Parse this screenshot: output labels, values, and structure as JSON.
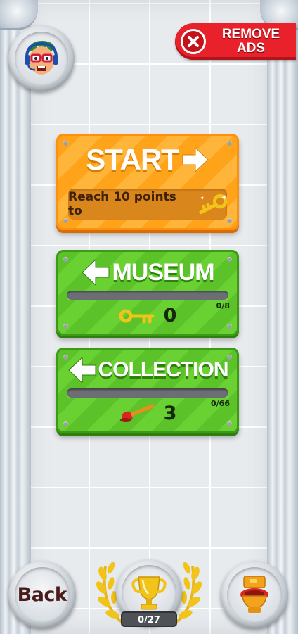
{
  "header": {
    "remove_ads_line1": "REMOVE",
    "remove_ads_line2": "ADS"
  },
  "start_card": {
    "title": "START",
    "hint": "Reach 10 points to"
  },
  "museum_card": {
    "title": "MUSEUM",
    "count": "0",
    "max_label": "0/8",
    "progress": 0
  },
  "collection_card": {
    "title": "COLLECTION",
    "count": "3",
    "max_label": "0/66",
    "progress": 0
  },
  "footer": {
    "back_label": "Back",
    "trophy_count": "0/27"
  },
  "icons": {
    "avatar": "player-avatar-icon",
    "close": "close-x-icon",
    "start_arrow": "arrow-right-icon",
    "key": "golden-key-icon",
    "museum_arrow": "arrow-left-icon",
    "plunger": "plunger-icon",
    "trophy": "trophy-icon",
    "toilet": "toilet-icon"
  },
  "colors": {
    "start_orange": "#ffa41a",
    "card_green": "#5cc22a",
    "remove_ads_red": "#e8212b"
  }
}
